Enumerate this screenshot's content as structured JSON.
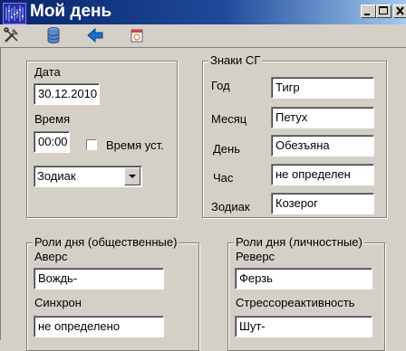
{
  "window": {
    "title": "Мой день"
  },
  "toolbar": {
    "icons": [
      "tools-icon",
      "database-icon",
      "back-arrow-icon",
      "calendar-icon"
    ]
  },
  "date_group": {
    "date_label": "Дата",
    "date_value": "30.12.2010",
    "time_label": "Время",
    "time_value": "00:00",
    "time_set_label": "Время уст.",
    "time_set_checked": false,
    "mode_value": "Зодиак"
  },
  "signs_group": {
    "caption": "Знаки СГ",
    "rows": [
      {
        "label": "Год",
        "value": "Тигр"
      },
      {
        "label": "Месяц",
        "value": "Петух"
      },
      {
        "label": "День",
        "value": "Обезъяна"
      },
      {
        "label": "Час",
        "value": "не определен"
      },
      {
        "label": "Зодиак",
        "value": "Козерог"
      }
    ]
  },
  "public_roles": {
    "caption": "Роли дня  (общественные)",
    "field1_label": "Аверс",
    "field1_value": "Вождь-",
    "field2_label": "Синхрон",
    "field2_value": "не определено"
  },
  "personal_roles": {
    "caption": "Роли дня (личностные)",
    "field1_label": "Реверс",
    "field1_value": "Ферзь",
    "field2_label": "Стрессореактивность",
    "field2_value": "Шут-"
  }
}
